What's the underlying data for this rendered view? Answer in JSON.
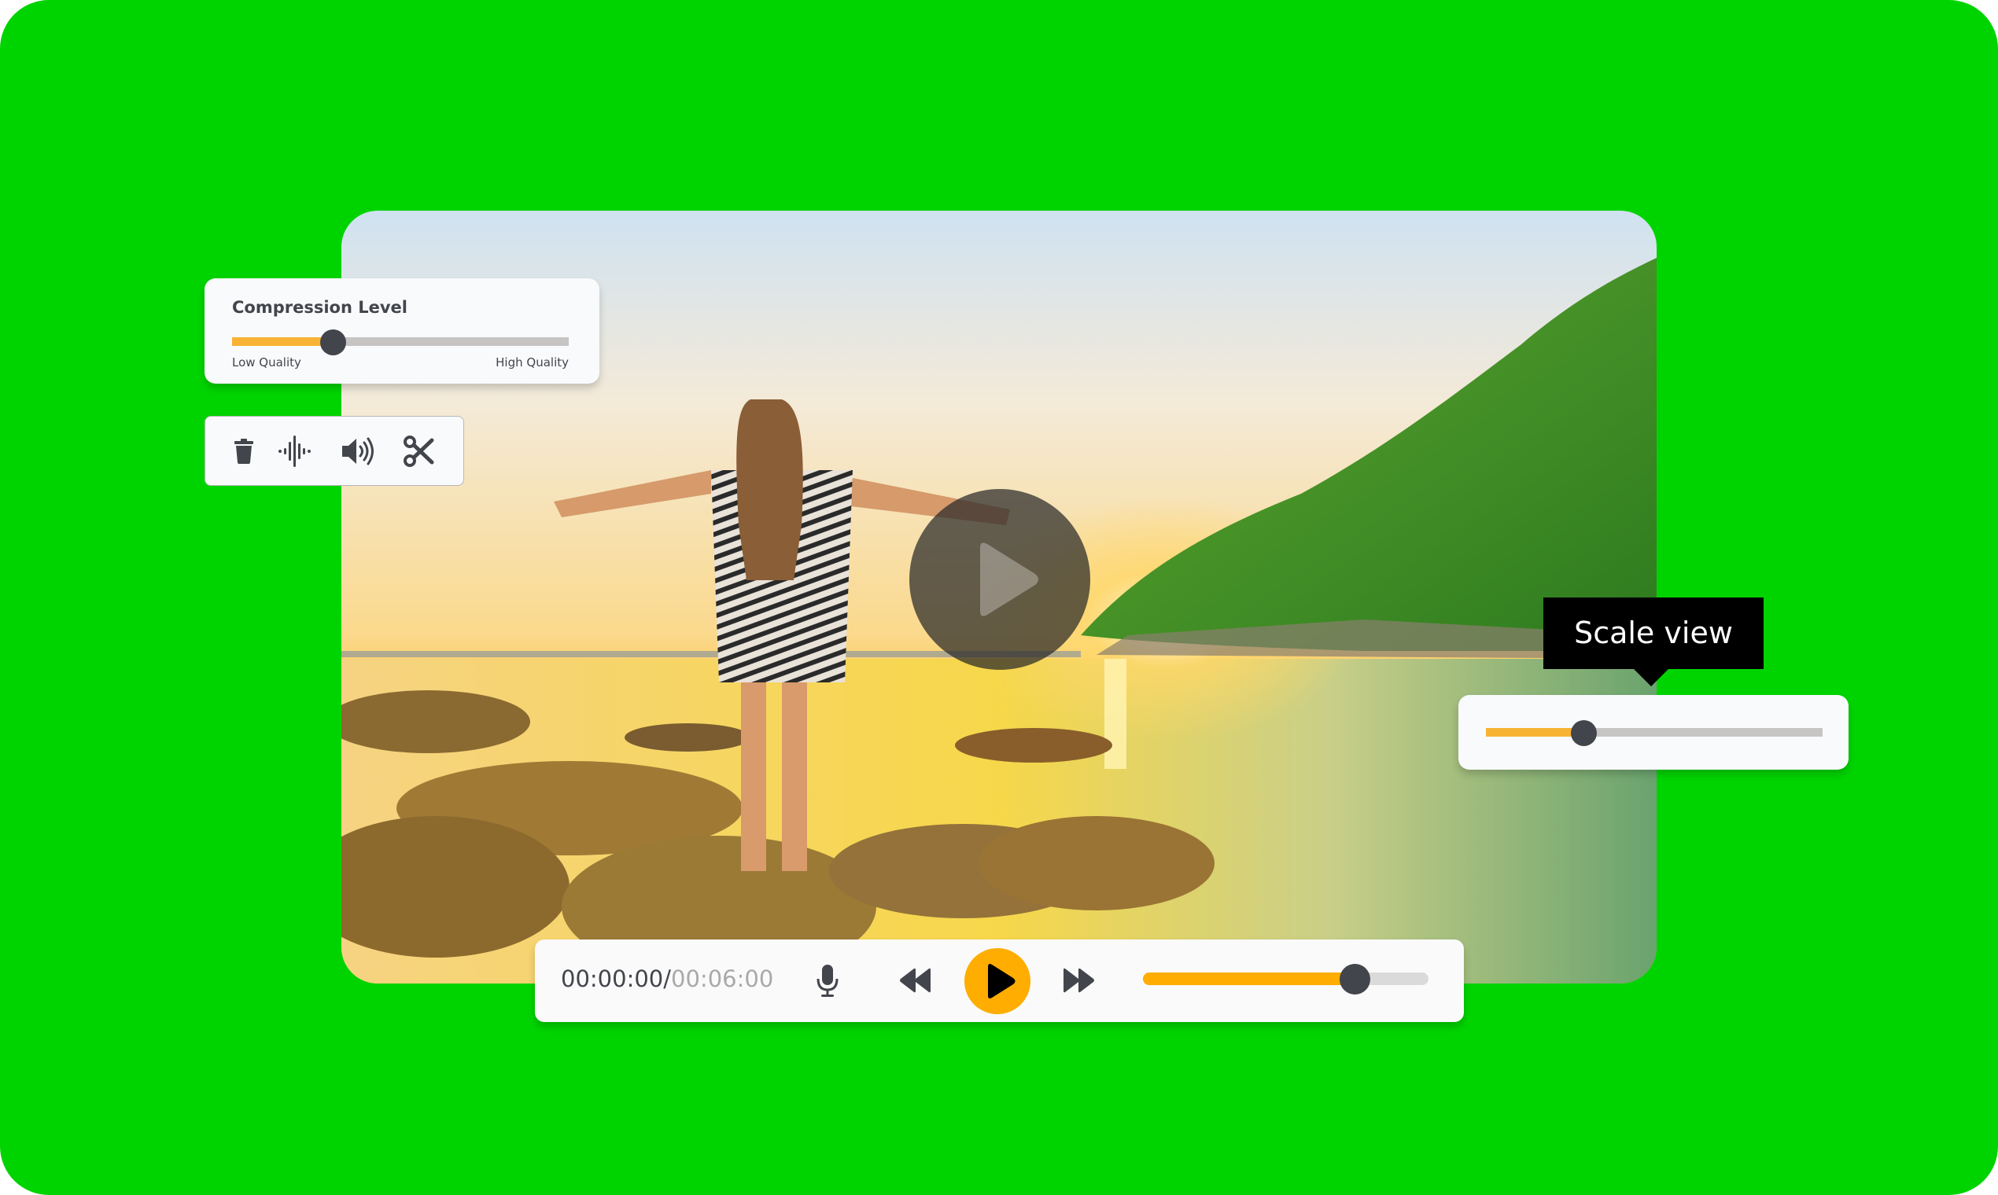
{
  "colors": {
    "background": "#00d400",
    "accent": "#ffad00",
    "slider_fill": "#f8b334",
    "slider_track": "#c6c5c4",
    "thumb": "#43454c",
    "card": "#f9fafc"
  },
  "video": {
    "description": "Woman in zebra-print dress with arms outstretched on rocks at a sunset beach with green hillside",
    "overlay_play_icon": "play-icon"
  },
  "compression": {
    "title": "Compression Level",
    "low_label": "Low Quality",
    "high_label": "High Quality",
    "value_percent": 30
  },
  "toolbar": {
    "tools": [
      {
        "name": "delete",
        "icon": "trash-icon"
      },
      {
        "name": "audio-waveform",
        "icon": "waveform-icon"
      },
      {
        "name": "volume",
        "icon": "speaker-icon"
      },
      {
        "name": "cut",
        "icon": "scissors-icon"
      }
    ]
  },
  "scale_view": {
    "tooltip": "Scale view",
    "value_percent": 29
  },
  "player": {
    "current_time": "00:00:00",
    "separator": "/",
    "duration": "00:06:00",
    "buttons": {
      "mic": "microphone-icon",
      "rewind": "rewind-icon",
      "play": "play-icon",
      "fast_forward": "fast-forward-icon"
    },
    "progress_percent": 74
  }
}
